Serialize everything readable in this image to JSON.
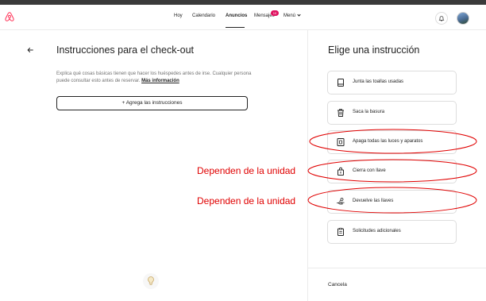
{
  "header": {
    "nav": [
      {
        "label": "Hoy",
        "active": false
      },
      {
        "label": "Calendario",
        "active": false
      },
      {
        "label": "Anuncios",
        "active": true
      },
      {
        "label": "Mensajes",
        "active": false
      },
      {
        "label": "Menú",
        "active": false
      }
    ],
    "messages_badge": "10",
    "brand_color": "#ff385c"
  },
  "left_panel": {
    "title": "Instrucciones para el check-out",
    "description": "Explica qué cosas básicas tienen que hacer los huéspedes antes de irse. Cualquier persona puede consultar esto antes de reservar.",
    "more_link": "Más información",
    "add_button": "+ Agrega las instrucciones"
  },
  "right_panel": {
    "title": "Elige una instrucción",
    "options": [
      {
        "label": "Junta las toallas usadas",
        "icon": "towel-icon"
      },
      {
        "label": "Saca la basura",
        "icon": "trash-icon"
      },
      {
        "label": "Apaga todas las luces y aparatos",
        "icon": "power-outlet-icon"
      },
      {
        "label": "Cierra con llave",
        "icon": "lock-icon"
      },
      {
        "label": "Devuelve las llaves",
        "icon": "hand-key-icon"
      },
      {
        "label": "Solicitudes adicionales",
        "icon": "clipboard-icon"
      }
    ],
    "cancel": "Cancela"
  },
  "annotations": {
    "color": "#e00000",
    "labels": [
      "Dependen de la unidad",
      "Dependen de la unidad"
    ]
  }
}
